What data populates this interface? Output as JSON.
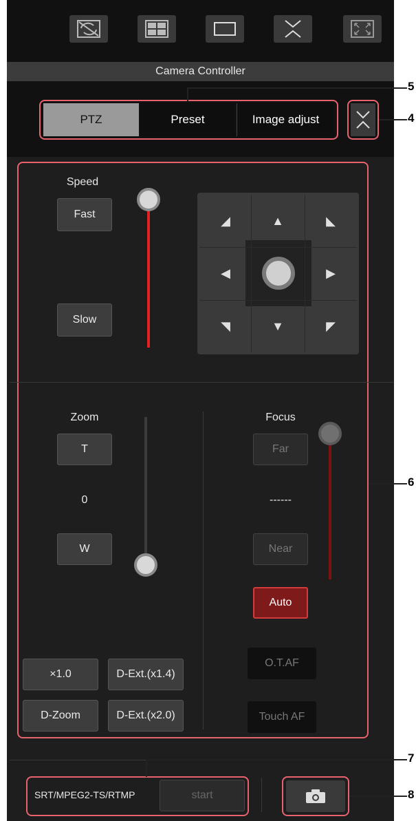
{
  "toolbar": {
    "icons": [
      "split-rotate-icon",
      "quad-view-icon",
      "single-view-icon",
      "collapse-icon",
      "fullscreen-icon"
    ]
  },
  "title": "Camera Controller",
  "tabs": {
    "ptz": "PTZ",
    "preset": "Preset",
    "image_adjust": "Image adjust"
  },
  "speed": {
    "label": "Speed",
    "fast": "Fast",
    "slow": "Slow",
    "level": 1.0
  },
  "zoom": {
    "label": "Zoom",
    "tele": "T",
    "value": "0",
    "wide": "W",
    "level": 0.0,
    "x1": "×1.0",
    "dext14": "D-Ext.(x1.4)",
    "dzoom": "D-Zoom",
    "dext20": "D-Ext.(x2.0)"
  },
  "focus": {
    "label": "Focus",
    "far": "Far",
    "value": "------",
    "near": "Near",
    "auto": "Auto",
    "otaf": "O.T.AF",
    "touchaf": "Touch AF",
    "level": 1.0
  },
  "stream": {
    "protocol": "SRT/MPEG2-TS/RTMP",
    "start": "start"
  },
  "callouts": {
    "c4": "4",
    "c5": "5",
    "c6": "6",
    "c7": "7",
    "c8": "8"
  },
  "colors": {
    "accent_red": "#e8636d",
    "slider_red": "#e22222",
    "panel": "#1e1e1e"
  }
}
